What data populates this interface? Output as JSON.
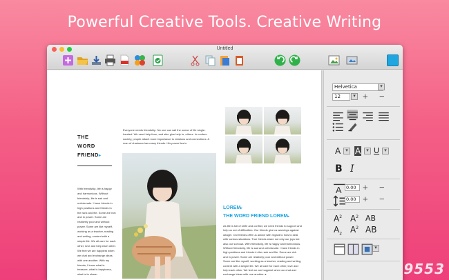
{
  "headline": "Powerful Creative Tools. Creative Writing",
  "window": {
    "title": "Untitled"
  },
  "colors": {
    "accent": "#1fa6e0",
    "close": "#fc5f57",
    "minimize": "#fdbb2d",
    "zoom": "#27c840"
  },
  "toolbar": {
    "icons": [
      "new-doc-icon",
      "open-folder-icon",
      "save-tray-icon",
      "print-icon",
      "pdf-icon",
      "share-icon",
      "checkmark-icon",
      "cut-icon",
      "copy-icon",
      "paste-icon",
      "clipboard-icon",
      "undo-icon",
      "redo-icon",
      "image-icon",
      "media-icon",
      "color-swatch-icon"
    ]
  },
  "document": {
    "left_title": [
      "THE",
      "WORD",
      "FRIEND"
    ],
    "left_arrow": "▸",
    "left_body": "With friendship, life is happy and harmonious. Without friendship, life is sad and unfortunate. I have friends in high positions and friends in the rank and file. Some are rich and in power. Some are relatively poor and without power. Some are like myself, working as a teacher, reading and writing, content with a simple life. We all care for each other, love and help each other. We feel we are happiest when we chat and exchange ideas with one another. With my friends, I know what is treasure, what is happiness, what is to share ·",
    "mid_body": "Everyone needs friendship. No one can sail the ocean of life single-handed. We need help from, and also give help to, others. In modern society, people attach more importance to relations and connections. A man of charisma has many friends. His power lies in",
    "lorem_label": "LOREM",
    "lorem_title": "THE WORD FRIEND LOREM",
    "lorem_arrow": "▸",
    "right_body": "As life is full of strife and conflict, we need friends to support and help us out of difficulties. Our friends give us warnings against danger. Our friends offer us advice with regard to how to deal with various situations. True friends share not only our joys but also our sorrows. With friendship, life is happy and harmonious. Without friendship, life is sad and unfortunate. I have friends in high positions and friends in the rank and file. Some are rich and in power. Some are relatively poor and without power. Some are like myself, working as a teacher, reading and writing, content with a simple life. We all care for each other, love and help each other. We feel we are happiest when we chat and exchange ideas with one another. ▸"
  },
  "panel": {
    "font_name": "Helvetica",
    "font_size": "12",
    "char_spacing": "0.00",
    "line_spacing": "0.00",
    "bold": "B",
    "italic": "I",
    "underline_sample": "U",
    "cap_sample": "A",
    "script_a": "A",
    "script_b": "A",
    "script_c": "AB",
    "sub_2": "2",
    "sup_2": "2",
    "plus": "+",
    "minus": "−"
  },
  "watermark": "9553"
}
